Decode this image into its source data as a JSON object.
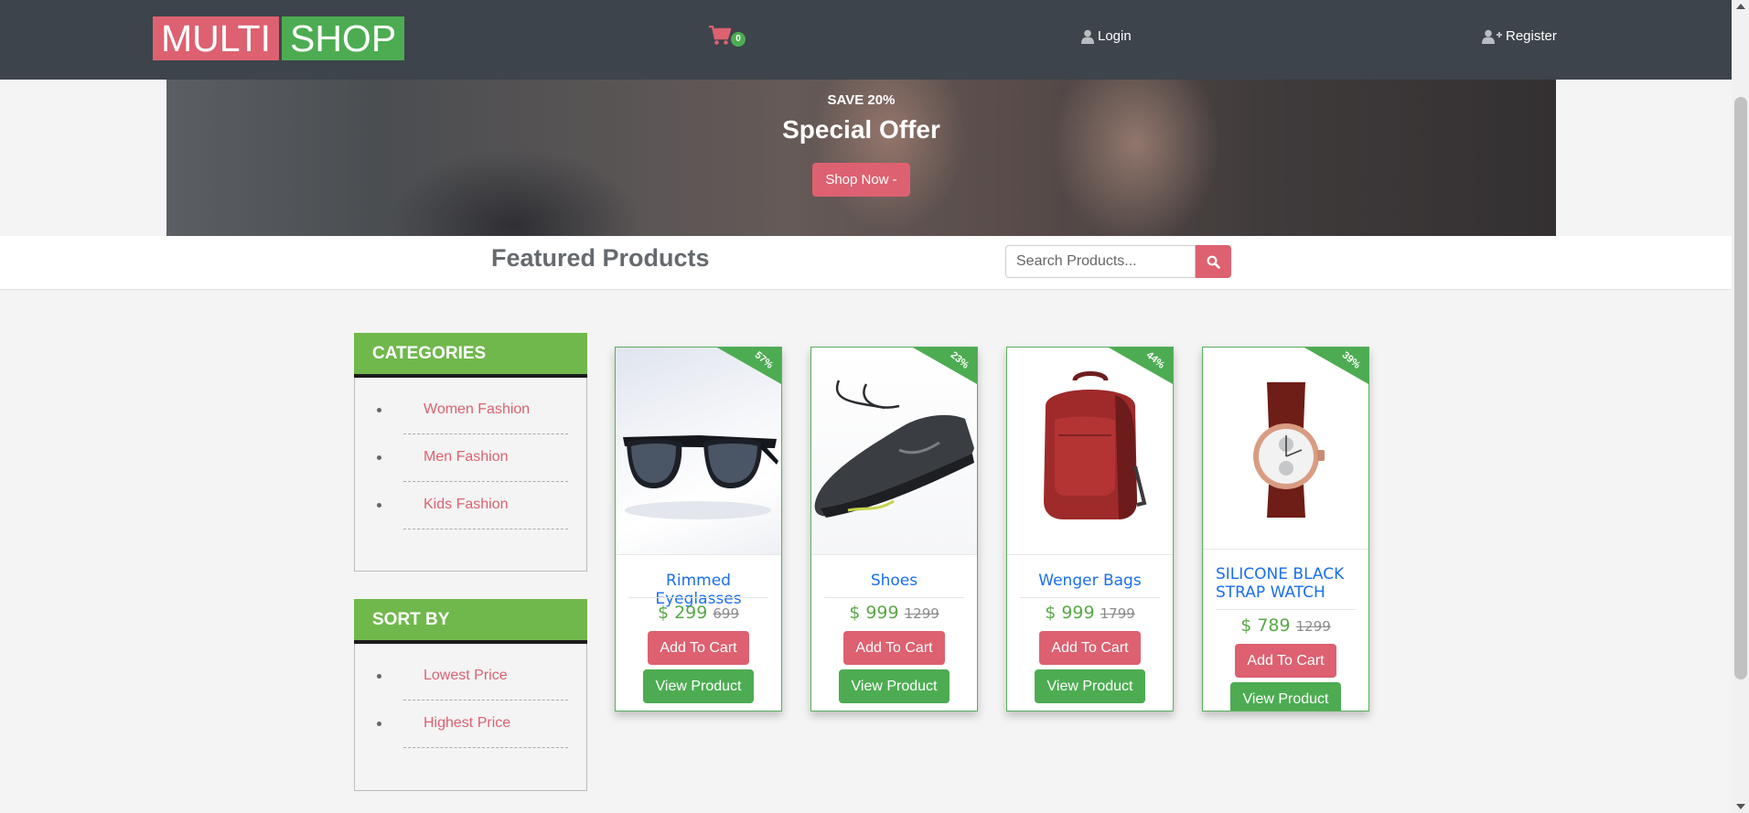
{
  "brand": {
    "part1": "MULTI",
    "part2": "SHOP"
  },
  "nav": {
    "cart_count": "0",
    "login_label": "Login",
    "register_label": "Register"
  },
  "hero": {
    "save_text": "SAVE 20%",
    "offer_title": "Special Offer",
    "cta_label": "Shop Now -"
  },
  "featured": {
    "title": "Featured Products",
    "search_placeholder": "Search Products..."
  },
  "sidebar": {
    "categories": {
      "title": "CATEGORIES",
      "items": [
        "Women Fashion",
        "Men Fashion",
        "Kids Fashion"
      ]
    },
    "sort": {
      "title": "SORT BY",
      "items": [
        "Lowest Price",
        "Highest Price"
      ]
    }
  },
  "products": [
    {
      "name": "Rimmed Eyeglasses",
      "price": "$ 299",
      "old_price": "699",
      "discount": "57%",
      "image": "sunglasses"
    },
    {
      "name": "Shoes",
      "price": "$ 999",
      "old_price": "1299",
      "discount": "23%",
      "image": "sneaker"
    },
    {
      "name": "Wenger Bags",
      "price": "$ 999",
      "old_price": "1799",
      "discount": "44%",
      "image": "backpack"
    },
    {
      "name": "SILICONE BLACK STRAP WATCH",
      "price": "$ 789",
      "old_price": "1299",
      "discount": "39%",
      "image": "watch"
    }
  ],
  "buttons": {
    "add_to_cart": "Add To Cart",
    "view_product": "View Product"
  },
  "colors": {
    "nav_bg": "#3d444b",
    "pink": "#dd6170",
    "green": "#4dac52",
    "panel_green": "#70b84c",
    "link_blue": "#1a6ef0"
  }
}
